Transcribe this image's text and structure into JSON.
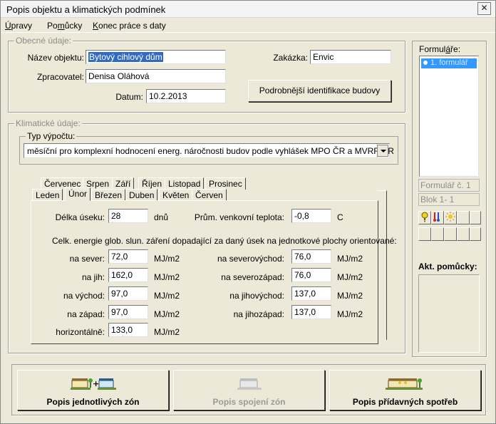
{
  "window": {
    "title": "Popis objektu a klimatických podmínek",
    "close_glyph": "✕"
  },
  "menu": [
    {
      "accel": "Ú",
      "rest": "pravy"
    },
    {
      "pre": "Po",
      "accel": "m",
      "rest": "ůcky"
    },
    {
      "accel": "K",
      "rest": "onec práce s daty"
    }
  ],
  "general": {
    "group_label": "Obecné údaje:",
    "object_name_label": "Název objektu:",
    "object_name_value": "Bytový cihlový dům",
    "contract_label": "Zakázka:",
    "contract_value": "Envic",
    "processor_label": "Zpracovatel:",
    "processor_value": "Denisa Oláhová",
    "date_label": "Datum:",
    "date_value": "10.2.2013",
    "detail_button": "Podrobnější identifikace budovy"
  },
  "climate": {
    "group_label": "Klimatické údaje:",
    "calc_type_label": "Typ výpočtu:",
    "calc_type_value": "měsíční  pro komplexní hodnocení energ. náročnosti budov podle vyhlášek MPO ČR a MVRR SR",
    "tabs_row_back": [
      "Červenec",
      "Srpen",
      "Září",
      "Říjen",
      "Listopad",
      "Prosinec"
    ],
    "tabs_row_front": [
      "Leden",
      "Únor",
      "Březen",
      "Duben",
      "Květen",
      "Červen"
    ],
    "active_tab": "Únor",
    "section_length_label": "Délka úseku:",
    "section_length_value": "28",
    "section_length_unit": "dnů",
    "avg_temp_label": "Prům. venkovní teplota:",
    "avg_temp_value": "-0,8",
    "avg_temp_unit": "C",
    "radiation_heading": "Celk. energie glob. slun. záření dopadající za daný úsek na jednotkové plochy orientované:",
    "unit": "MJ/m2",
    "left": [
      {
        "label": "na sever:",
        "value": "72,0"
      },
      {
        "label": "na jih:",
        "value": "162,0"
      },
      {
        "label": "na východ:",
        "value": "97,0"
      },
      {
        "label": "na západ:",
        "value": "97,0"
      },
      {
        "label": "horizontálně:",
        "value": "133,0"
      }
    ],
    "right": [
      {
        "label": "na severovýchod:",
        "value": "76,0"
      },
      {
        "label": "na severozápad:",
        "value": "76,0"
      },
      {
        "label": "na jihovýchod:",
        "value": "137,0"
      },
      {
        "label": "na jihozápad:",
        "value": "137,0"
      }
    ]
  },
  "forms": {
    "label_pre": "Formul",
    "label_accel": "á",
    "label_post": "ře:",
    "list_items": [
      "1. formulář"
    ],
    "form_no": "Formulář č.  1",
    "block_no": "Blok  1-  1",
    "tool_icons": [
      "question-icon",
      "thermometer-icon",
      "sun-icon"
    ],
    "aids_label": "Akt. pomůcky:"
  },
  "bottom_buttons": [
    {
      "label": "Popis jednotlivých zón",
      "enabled": true
    },
    {
      "label": "Popis spojení zón",
      "enabled": false
    },
    {
      "label": "Popis přídavných spotřeb",
      "enabled": true
    }
  ]
}
